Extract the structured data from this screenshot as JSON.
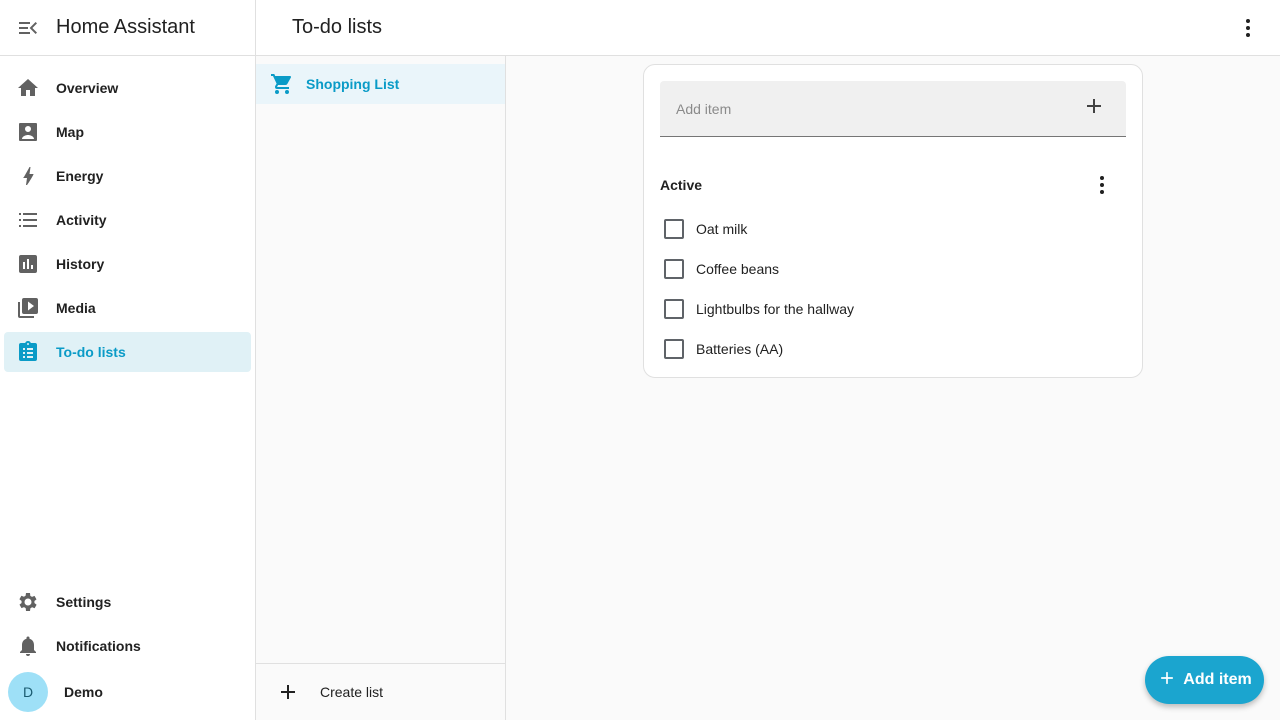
{
  "app": {
    "title": "Home Assistant"
  },
  "sidebar": {
    "items": [
      {
        "label": "Overview",
        "icon": "home-icon"
      },
      {
        "label": "Map",
        "icon": "map-icon"
      },
      {
        "label": "Energy",
        "icon": "lightning-icon"
      },
      {
        "label": "Activity",
        "icon": "list-icon"
      },
      {
        "label": "History",
        "icon": "chart-icon"
      },
      {
        "label": "Media",
        "icon": "media-icon"
      },
      {
        "label": "To-do lists",
        "icon": "clipboard-list-icon",
        "active": true
      }
    ],
    "bottom": [
      {
        "label": "Settings",
        "icon": "gear-icon"
      },
      {
        "label": "Notifications",
        "icon": "bell-icon"
      }
    ],
    "user": {
      "initial": "D",
      "name": "Demo"
    }
  },
  "header": {
    "title": "To-do lists"
  },
  "lists": {
    "items": [
      {
        "label": "Shopping List",
        "icon": "cart-icon",
        "selected": true
      }
    ],
    "create_label": "Create list"
  },
  "card": {
    "add_placeholder": "Add item",
    "section_title": "Active",
    "items": [
      {
        "label": "Oat milk",
        "checked": false
      },
      {
        "label": "Coffee beans",
        "checked": false
      },
      {
        "label": "Lightbulbs for the hallway",
        "checked": false
      },
      {
        "label": "Batteries (AA)",
        "checked": false
      }
    ]
  },
  "fab": {
    "label": "Add item"
  },
  "colors": {
    "accent": "#0a9bc7",
    "fab": "#1ba5cf",
    "active_bg": "#e0f1f6",
    "avatar": "#9ee0f7"
  }
}
